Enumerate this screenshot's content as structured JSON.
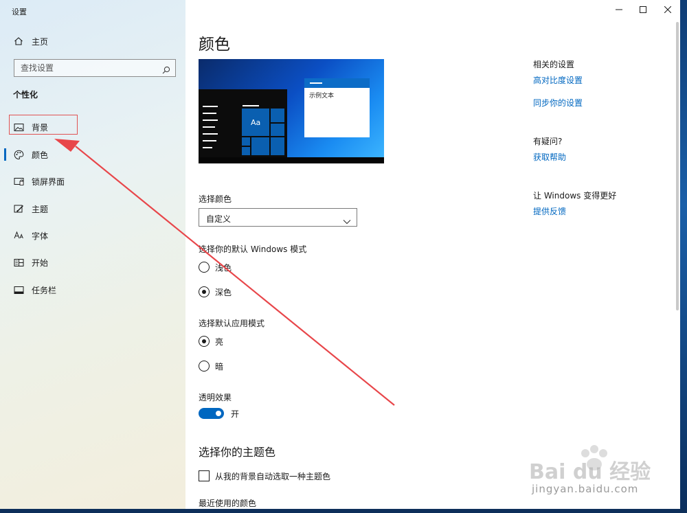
{
  "window": {
    "app_title": "设置"
  },
  "sidebar": {
    "home_label": "主页",
    "search_placeholder": "查找设置",
    "section_title": "个性化",
    "items": [
      {
        "label": "背景",
        "icon": "picture-icon"
      },
      {
        "label": "颜色",
        "icon": "palette-icon"
      },
      {
        "label": "锁屏界面",
        "icon": "lock-screen-icon"
      },
      {
        "label": "主题",
        "icon": "theme-brush-icon"
      },
      {
        "label": "字体",
        "icon": "font-icon"
      },
      {
        "label": "开始",
        "icon": "start-icon"
      },
      {
        "label": "任务栏",
        "icon": "taskbar-icon"
      }
    ],
    "selected_index": 1
  },
  "main": {
    "title": "颜色",
    "preview": {
      "sample_text": "示例文本",
      "tile_label": "Aa"
    },
    "choose_color": {
      "label": "选择颜色",
      "selected": "自定义"
    },
    "windows_mode": {
      "label": "选择你的默认 Windows 模式",
      "options": [
        {
          "label": "浅色",
          "checked": false
        },
        {
          "label": "深色",
          "checked": true
        }
      ]
    },
    "app_mode": {
      "label": "选择默认应用模式",
      "options": [
        {
          "label": "亮",
          "checked": true
        },
        {
          "label": "暗",
          "checked": false
        }
      ]
    },
    "transparency": {
      "label": "透明效果",
      "state": "开",
      "on": true
    },
    "accent": {
      "heading": "选择你的主题色",
      "auto_label": "从我的背景自动选取一种主题色",
      "auto_checked": false,
      "recent_label": "最近使用的颜色"
    }
  },
  "related": {
    "heading": "相关的设置",
    "links": [
      "高对比度设置",
      "同步你的设置"
    ],
    "help_heading": "有疑问?",
    "help_link": "获取帮助",
    "feedback_heading": "让 Windows 变得更好",
    "feedback_link": "提供反馈"
  },
  "watermark": {
    "logo_text": "Bai du 经验",
    "url": "jingyan.baidu.com"
  },
  "colors": {
    "accent": "#0067c0",
    "annotation": "#e05252"
  }
}
